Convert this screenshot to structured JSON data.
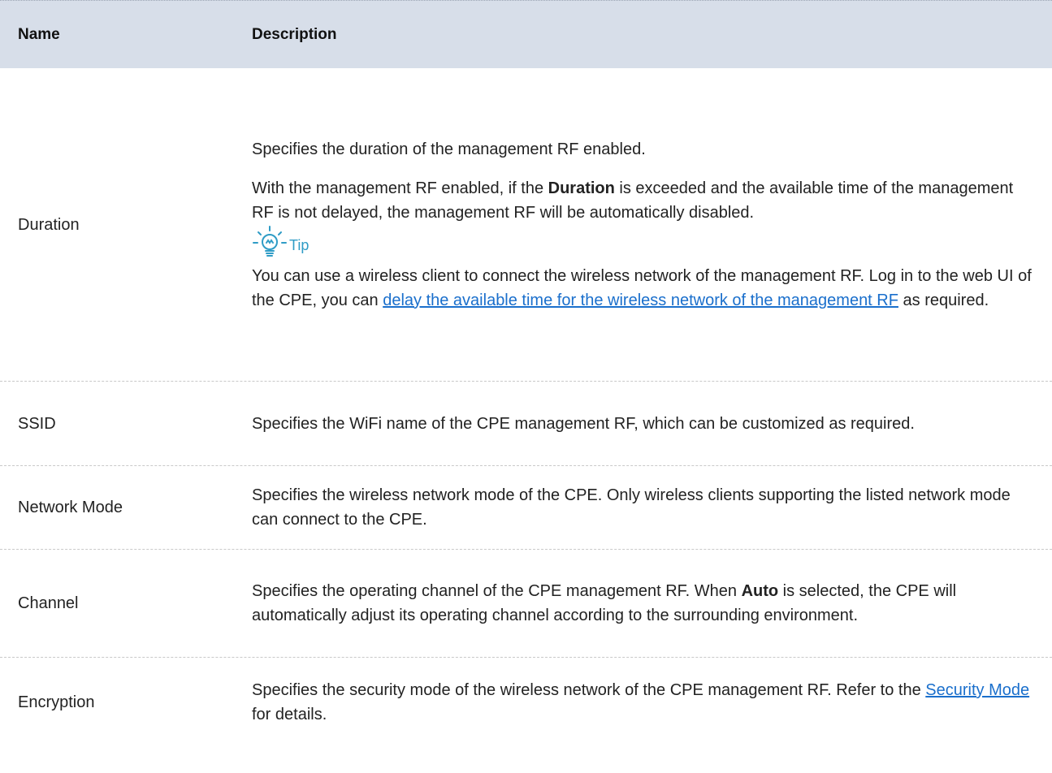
{
  "header": {
    "name_label": "Name",
    "description_label": "Description"
  },
  "rows": [
    {
      "name": "Duration",
      "p1": "Specifies the duration of the management RF enabled.",
      "p2_a": "With the management RF enabled, if the ",
      "p2_bold": "Duration",
      "p2_b": " is exceeded and the available time of the management RF is not delayed, the management RF will be automatically disabled.",
      "tip_label": "Tip",
      "tip_a": "You can use a wireless client to connect the wireless network of the management RF. Log in to the web UI of the CPE, you can ",
      "tip_link": "delay the available time for the wireless network of the management RF",
      "tip_b": " as required."
    },
    {
      "name": "SSID",
      "desc": "Specifies the WiFi name of the CPE management RF, which can be customized as required."
    },
    {
      "name": "Network Mode",
      "desc": "Specifies the wireless network mode of the CPE. Only wireless clients supporting the listed network mode can connect to the CPE."
    },
    {
      "name": "Channel",
      "desc_a": "Specifies the operating channel of the CPE management RF. When ",
      "desc_bold": "Auto",
      "desc_b": " is selected, the CPE will automatically adjust its operating channel according to the surrounding environment."
    },
    {
      "name": "Encryption",
      "desc_a": "Specifies the security mode of the wireless network of the CPE management RF. Refer to the ",
      "desc_link": "Security Mode",
      "desc_b": " for details."
    }
  ],
  "colors": {
    "header_bg": "#d7dee9",
    "link": "#1a6fcc",
    "tip": "#2f9cc6"
  },
  "icons": {
    "tip": "lightbulb-icon"
  }
}
